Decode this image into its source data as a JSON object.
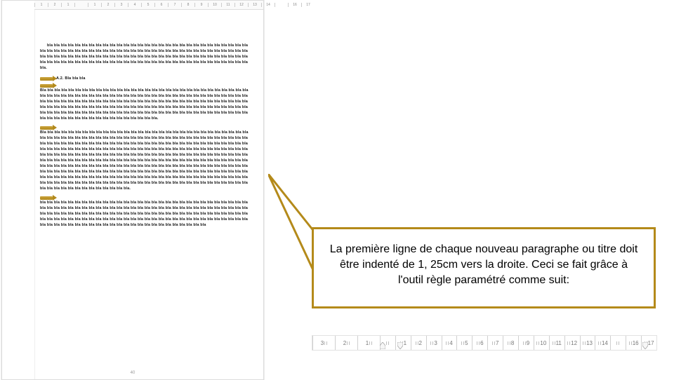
{
  "ruler_top": [
    "1",
    "2",
    "1",
    "",
    "1",
    "2",
    "3",
    "4",
    "5",
    "6",
    "7",
    "8",
    "9",
    "10",
    "11",
    "12",
    "13",
    "14",
    "",
    "16",
    "17"
  ],
  "doc": {
    "para1": "bla bla bla bla bla bla bla bla bla bla bla bla bla bla bla bla bla bla bla bla bla bla bla bla bla bla bla bla bla bla bla bla bla bla bla bla bla bla bla bla bla bla bla bla bla bla bla bla bla bla bla bla bla bla bla bla bla bla bla bla bla bla bla bla bla bla bla bla bla bla bla bla bla bla bla bla bla bla bla bla bla bla bla bla bla bla bla bla bla bla bla bla bla bla bla bla bla bla bla bla bla bla bla bla bla bla bla bla bla bla bla bla bla bla bla bla bla bla bla bla.",
    "heading": "A.2. Bla bla bla",
    "para2": "Bla bla bla bla bla bla bla bla bla bla bla bla bla bla bla bla bla bla bla bla bla bla bla bla bla bla bla bla bla bla bla bla bla bla bla bla bla bla bla bla bla bla bla bla bla bla bla bla bla bla bla bla bla bla bla bla bla bla bla bla bla bla bla bla bla bla bla bla bla bla bla bla bla bla bla bla bla bla bla bla bla bla bla bla bla bla bla bla bla bla bla bla bla bla bla bla bla bla bla bla bla bla bla bla bla bla bla bla bla bla bla bla bla bla bla bla bla bla bla bla bla bla bla bla bla bla bla bla bla bla bla bla bla bla bla bla bla bla bla bla bla bla bla bla bla bla bla bla bla bla bla bla bla bla bla bla bla bla bla bla bla bla bla bla bla bla bla.",
    "para3": "Bla bla bla bla bla bla bla bla bla bla bla bla bla bla bla bla bla bla bla bla bla bla bla bla bla bla bla bla bla bla bla bla bla bla bla bla bla bla bla bla bla bla bla bla bla bla bla bla bla bla bla bla bla bla bla bla bla bla bla bla bla bla bla bla bla bla bla bla bla bla bla bla bla bla bla bla bla bla bla bla bla bla bla bla bla bla bla bla bla bla bla bla bla bla bla bla bla bla bla bla bla bla bla bla bla bla bla bla bla bla bla bla bla bla bla bla bla bla bla bla bla bla bla bla bla bla bla bla bla bla bla bla bla bla bla bla bla bla bla bla bla bla bla bla bla bla bla bla bla bla bla bla bla bla bla bla bla bla bla bla bla bla bla bla bla bla bla bla bla bla bla bla bla bla bla bla bla bla bla bla bla bla bla bla bla bla bla bla bla bla bla bla bla bla bla bla bla bla bla bla bla bla bla bla bla bla bla bla bla bla bla bla bla bla bla bla bla bla bla bla bla bla bla bla bla bla bla bla bla bla bla bla bla bla bla bla bla bla bla bla bla bla bla bla bla bla bla bla bla bla bla bla bla bla bla bla bla bla bla bla bla bla bla bla bla bla bla bla bla bla bla bla bla bla bla bla bla bla bla bla bla bla bla bla bla bla bla bla bla bla bla bla bla bla bla bla bla bla bla bla bla bla bla bla bla bla bla bla bla bla bla bla bla.",
    "para4": "bla bla bla bla bla bla bla bla bla bla bla bla bla bla bla bla bla bla bla bla bla bla bla bla bla bla bla bla bla bla bla bla bla bla bla bla bla bla bla bla bla bla bla bla bla bla bla bla bla bla bla bla bla bla bla bla bla bla bla bla bla bla bla bla bla bla bla bla bla bla bla bla bla bla bla bla bla bla bla bla bla bla bla bla bla bla bla bla bla bla bla bla bla bla bla bla bla bla bla bla bla bla bla bla bla bla bla bla bla bla bla bla bla bla bla bla bla bla bla bla bla bla bla bla bla bla bla bla bla bla bla bla bla bla bla bla bla bla bla bla bla bla bla bla",
    "pagenum": "40"
  },
  "callout": {
    "text": "La première ligne de chaque nouveau paragraphe ou titre doit être indenté de 1, 25cm vers la droite. Ceci se fait grâce à l'outil règle paramétré comme suit:"
  },
  "ruler2": {
    "neg": [
      "3",
      "2",
      "1"
    ],
    "pos": [
      "",
      "1",
      "2",
      "3",
      "4",
      "5",
      "6",
      "7",
      "8",
      "9",
      "10",
      "11",
      "12",
      "13",
      "14",
      "",
      "16",
      "17"
    ]
  },
  "colors": {
    "accent": "#b48a1a"
  }
}
